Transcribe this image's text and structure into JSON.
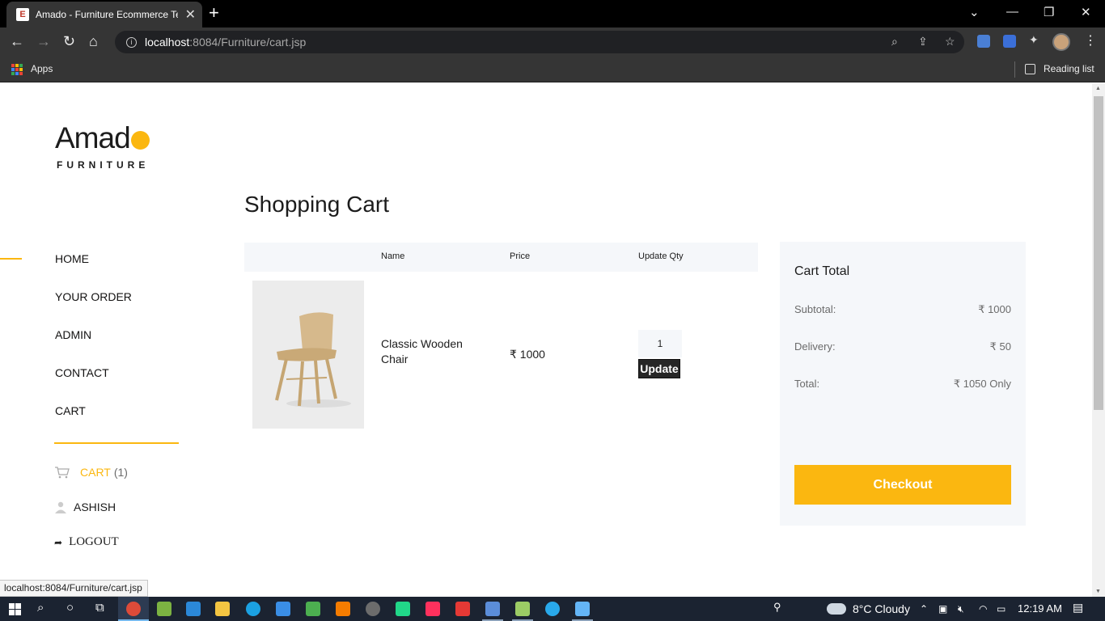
{
  "browser": {
    "tab_title": "Amado - Furniture Ecommerce Te",
    "tab_favicon": "E",
    "url_host": "localhost",
    "url_path": ":8084/Furniture/cart.jsp",
    "bookmarks_apps": "Apps",
    "reading_list": "Reading list",
    "status_url": "localhost:8084/Furniture/cart.jsp"
  },
  "brand": {
    "name": "Amad",
    "tagline": "FURNITURE",
    "accent_color": "#fbb710"
  },
  "nav": {
    "items": [
      {
        "label": "HOME",
        "active": true
      },
      {
        "label": "YOUR ORDER"
      },
      {
        "label": "ADMIN"
      },
      {
        "label": "CONTACT"
      },
      {
        "label": "CART"
      }
    ]
  },
  "sidebar": {
    "cart_label": "CART",
    "cart_count": "(1)",
    "user_name": "ASHISH",
    "logout_label": "LOGOUT"
  },
  "cart": {
    "title": "Shopping Cart",
    "columns": {
      "name": "Name",
      "price": "Price",
      "qty": "Update Qty"
    },
    "items": [
      {
        "name": "Classic Wooden Chair",
        "price": "₹ 1000",
        "qty": "1",
        "update_label": "Update"
      }
    ]
  },
  "summary": {
    "title": "Cart Total",
    "subtotal_label": "Subtotal:",
    "subtotal_value": "₹ 1000",
    "delivery_label": "Delivery:",
    "delivery_value": "₹ 50",
    "total_label": "Total:",
    "total_value": "₹ 1050 Only",
    "checkout_label": "Checkout"
  },
  "taskbar": {
    "weather": "8°C  Cloudy",
    "time": "12:19 AM"
  }
}
